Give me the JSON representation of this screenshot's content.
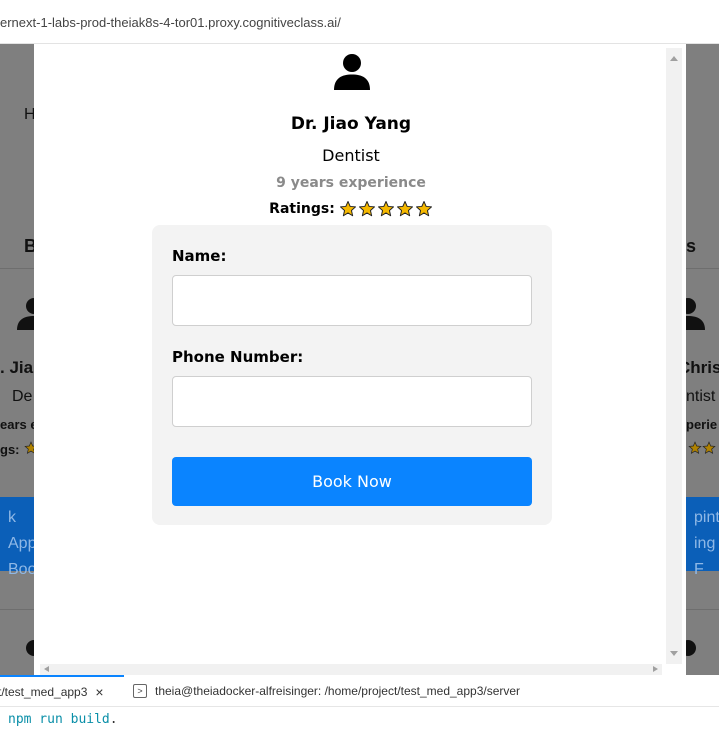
{
  "browser": {
    "url": "ernext-1-labs-prod-theiak8s-4-tor01.proxy.cognitiveclass.ai/"
  },
  "background": {
    "left_heading_fragment": "H",
    "left_col_heading_fragment": "B",
    "right_col_heading_fragment": "s",
    "left_card": {
      "name_fragment": ". Jia",
      "spec_fragment": "De",
      "exp_fragment": "ears e",
      "ratings_fragment": "gs:",
      "button_line1": "k App",
      "button_line2": "Boo"
    },
    "right_card": {
      "name_fragment": "Chris",
      "spec_fragment": "ntist",
      "exp_fragment": "perie",
      "button_line1": "pintn",
      "button_line2": "ing F"
    }
  },
  "modal": {
    "doctor": {
      "name": "Dr. Jiao Yang",
      "specialty": "Dentist",
      "experience": "9 years experience",
      "ratings_label": "Ratings:",
      "rating_stars": 5
    },
    "form": {
      "name_label": "Name:",
      "name_value": "",
      "phone_label": "Phone Number:",
      "phone_value": "",
      "submit_label": "Book Now"
    }
  },
  "terminal": {
    "tab_active_label": "t/test_med_app3",
    "tab_close": "×",
    "tab_second_label": "theia@theiadocker-alfreisinger: /home/project/test_med_app3/server",
    "command": "npm run build",
    "command_suffix": "."
  },
  "colors": {
    "accent": "#0a84ff",
    "overlay": "#7f7f7f",
    "star_fill": "#f5b800",
    "bg_button": "#0b5fb8"
  }
}
